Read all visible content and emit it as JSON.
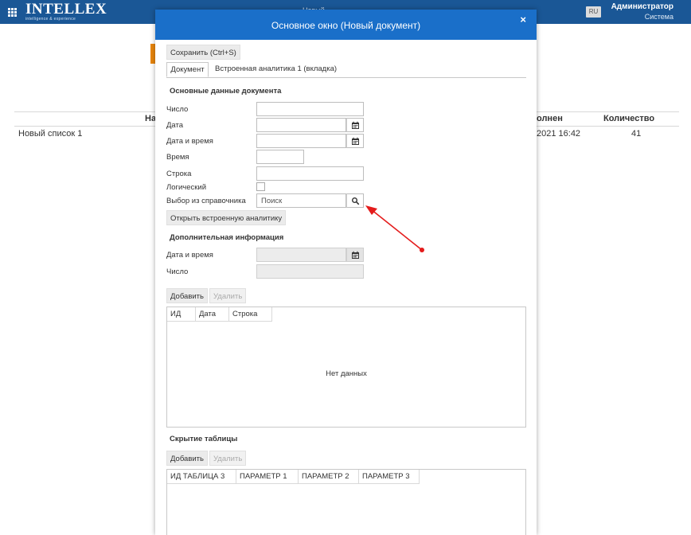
{
  "topbar": {
    "logo_word": "INTELLEX",
    "logo_tagline": "intelligence & experience",
    "center_title": "Новый",
    "language": "RU",
    "user_name": "Администратор",
    "user_role": "Система"
  },
  "background_table": {
    "headers": [
      "На",
      "олнен",
      "Количество"
    ],
    "rows": [
      {
        "name": "Новый список 1",
        "date": "2021 16:42",
        "count": "41"
      }
    ]
  },
  "modal": {
    "title": "Основное окно (Новый документ)",
    "close_glyph": "×",
    "save_button": "Сохранить (Ctrl+S)",
    "tabs": [
      "Документ",
      "Встроенная аналитика 1 (вкладка)"
    ],
    "main_section": {
      "title": "Основные данные документа",
      "fields": {
        "number": "Число",
        "date": "Дата",
        "datetime": "Дата и время",
        "time": "Время",
        "string": "Строка",
        "logical": "Логический",
        "lookup": "Выбор из справочника"
      },
      "lookup_placeholder": "Поиск",
      "open_analytics_button": "Открыть встроенную аналитику"
    },
    "extra_section": {
      "title": "Дополнительная информация",
      "fields": {
        "datetime": "Дата и время",
        "number": "Число"
      }
    },
    "grid1": {
      "add_button": "Добавить",
      "delete_button": "Удалить",
      "columns": [
        "ИД",
        "Дата",
        "Строка"
      ],
      "empty_text": "Нет данных"
    },
    "hidden_table_section": {
      "title": "Скрытие таблицы",
      "add_button": "Добавить",
      "delete_button": "Удалить",
      "columns": [
        "ИД ТАБЛИЦА 3",
        "ПАРАМЕТР 1",
        "ПАРАМЕТР 2",
        "ПАРАМЕТР 3"
      ]
    }
  },
  "icons": {
    "apps": "grid-icon",
    "close": "close-icon",
    "calendar": "calendar-icon",
    "search": "search-icon"
  },
  "colors": {
    "topbar": "#1a5796",
    "modal_header": "#1a6fc9",
    "accent_orange": "#e8850b",
    "annotation_arrow": "#e41b1b"
  }
}
